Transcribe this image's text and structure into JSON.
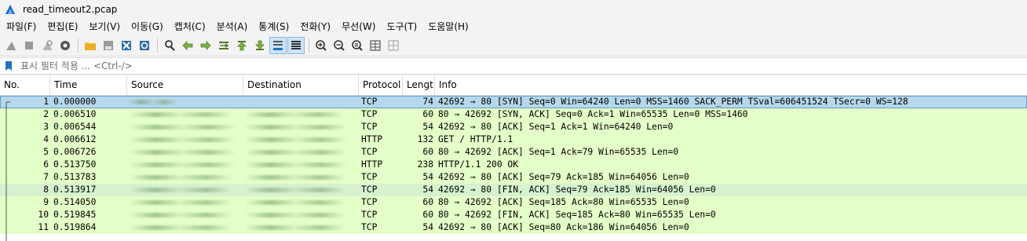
{
  "window": {
    "title": "read_timeout2.pcap"
  },
  "menu": [
    "파일(F)",
    "편집(E)",
    "보기(V)",
    "이동(G)",
    "캡처(C)",
    "분석(A)",
    "통계(S)",
    "전화(Y)",
    "무선(W)",
    "도구(T)",
    "도움말(H)"
  ],
  "toolbar": {
    "icons": [
      "shark-fin-start-icon",
      "stop-capture-icon",
      "restart-capture-icon",
      "capture-options-icon",
      "open-file-icon",
      "save-file-icon",
      "close-file-icon",
      "reload-file-icon",
      "find-packet-icon",
      "go-back-icon",
      "go-forward-icon",
      "go-to-packet-icon",
      "go-first-packet-icon",
      "go-last-packet-icon",
      "auto-scroll-icon",
      "colorize-icon",
      "zoom-in-icon",
      "zoom-out-icon",
      "normal-size-icon",
      "resize-columns-icon"
    ]
  },
  "filter": {
    "placeholder": "표시 필터 적용 ... <Ctrl-/>",
    "value": ""
  },
  "columns": [
    "No.",
    "Time",
    "Source",
    "Destination",
    "Protocol",
    "Lengt",
    "Info"
  ],
  "packets": [
    {
      "no": "1",
      "time": "0.000000",
      "protocol": "TCP",
      "length": "74",
      "info": "42692 → 80 [SYN] Seq=0 Win=64240 Len=0 MSS=1460 SACK_PERM TSval=606451524 TSecr=0 WS=128"
    },
    {
      "no": "2",
      "time": "0.006510",
      "protocol": "TCP",
      "length": "60",
      "info": "80 → 42692 [SYN, ACK] Seq=0 Ack=1 Win=65535 Len=0 MSS=1460"
    },
    {
      "no": "3",
      "time": "0.006544",
      "protocol": "TCP",
      "length": "54",
      "info": "42692 → 80 [ACK] Seq=1 Ack=1 Win=64240 Len=0"
    },
    {
      "no": "4",
      "time": "0.006612",
      "protocol": "HTTP",
      "length": "132",
      "info": "GET / HTTP/1.1"
    },
    {
      "no": "5",
      "time": "0.006726",
      "protocol": "TCP",
      "length": "60",
      "info": "80 → 42692 [ACK] Seq=1 Ack=79 Win=65535 Len=0"
    },
    {
      "no": "6",
      "time": "0.513750",
      "protocol": "HTTP",
      "length": "238",
      "info": "HTTP/1.1 200 OK"
    },
    {
      "no": "7",
      "time": "0.513783",
      "protocol": "TCP",
      "length": "54",
      "info": "42692 → 80 [ACK] Seq=79 Ack=185 Win=64056 Len=0"
    },
    {
      "no": "8",
      "time": "0.513917",
      "protocol": "TCP",
      "length": "54",
      "info": "42692 → 80 [FIN, ACK] Seq=79 Ack=185 Win=64056 Len=0"
    },
    {
      "no": "9",
      "time": "0.514050",
      "protocol": "TCP",
      "length": "60",
      "info": "80 → 42692 [ACK] Seq=185 Ack=80 Win=65535 Len=0"
    },
    {
      "no": "10",
      "time": "0.519845",
      "protocol": "TCP",
      "length": "60",
      "info": "80 → 42692 [FIN, ACK] Seq=185 Ack=80 Win=65535 Len=0"
    },
    {
      "no": "11",
      "time": "0.519864",
      "protocol": "TCP",
      "length": "54",
      "info": "42692 → 80 [ACK] Seq=80 Ack=186 Win=64056 Len=0"
    }
  ],
  "colors": {
    "row_green": "#e4ffc7",
    "row_selected": "#b7d8ec",
    "row_alt": "#d6f2cf",
    "accent": "#1e73be"
  }
}
